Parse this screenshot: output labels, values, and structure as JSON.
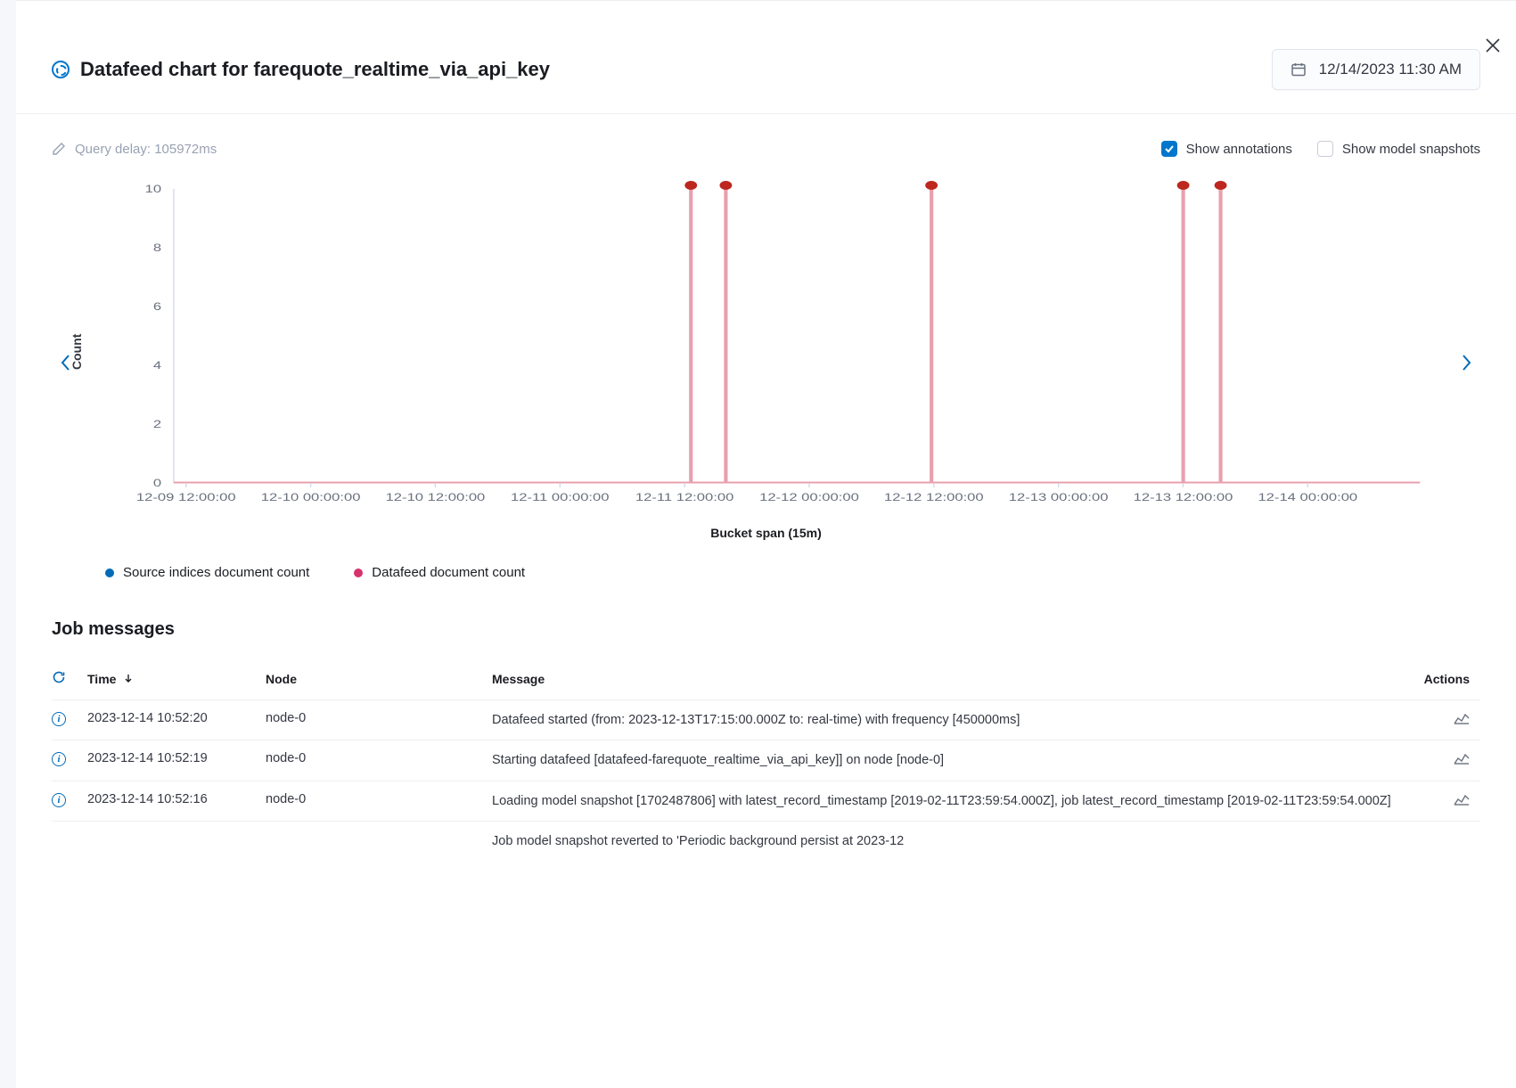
{
  "header": {
    "title": "Datafeed chart for farequote_realtime_via_api_key",
    "date": "12/14/2023 11:30 AM"
  },
  "controls": {
    "query_delay": "Query delay: 105972ms",
    "show_annotations_label": "Show annotations",
    "show_snapshots_label": "Show model snapshots"
  },
  "chart_data": {
    "type": "bar",
    "title": "",
    "ylabel": "Count",
    "xlabel": "Bucket span (15m)",
    "ylim": [
      0,
      10
    ],
    "y_ticks": [
      0,
      2,
      4,
      6,
      8,
      10
    ],
    "x_ticks": [
      "12-09 12:00:00",
      "12-10 00:00:00",
      "12-10 12:00:00",
      "12-11 00:00:00",
      "12-11 12:00:00",
      "12-12 00:00:00",
      "12-12 12:00:00",
      "12-13 00:00:00",
      "12-13 12:00:00",
      "12-14 00:00:00"
    ],
    "bars": [
      {
        "x_frac": 0.415,
        "value": 10.5
      },
      {
        "x_frac": 0.443,
        "value": 10.5
      },
      {
        "x_frac": 0.608,
        "value": 10.5
      },
      {
        "x_frac": 0.81,
        "value": 10.5
      },
      {
        "x_frac": 0.84,
        "value": 10.5
      }
    ],
    "legend": [
      {
        "label": "Source indices document count",
        "color": "#006bb8"
      },
      {
        "label": "Datafeed document count",
        "color": "#d6336c"
      }
    ]
  },
  "messages": {
    "title": "Job messages",
    "columns": {
      "time": "Time",
      "node": "Node",
      "message": "Message",
      "actions": "Actions"
    },
    "rows": [
      {
        "time": "2023-12-14 10:52:20",
        "node": "node-0",
        "message": "Datafeed started (from: 2023-12-13T17:15:00.000Z to: real-time) with frequency [450000ms]"
      },
      {
        "time": "2023-12-14 10:52:19",
        "node": "node-0",
        "message": "Starting datafeed [datafeed-farequote_realtime_via_api_key]] on node [node-0]"
      },
      {
        "time": "2023-12-14 10:52:16",
        "node": "node-0",
        "message": "Loading model snapshot [1702487806] with latest_record_timestamp [2019-02-11T23:59:54.000Z], job latest_record_timestamp [2019-02-11T23:59:54.000Z]"
      }
    ],
    "partial_row": "Job model snapshot reverted to 'Periodic background persist at 2023-12"
  }
}
